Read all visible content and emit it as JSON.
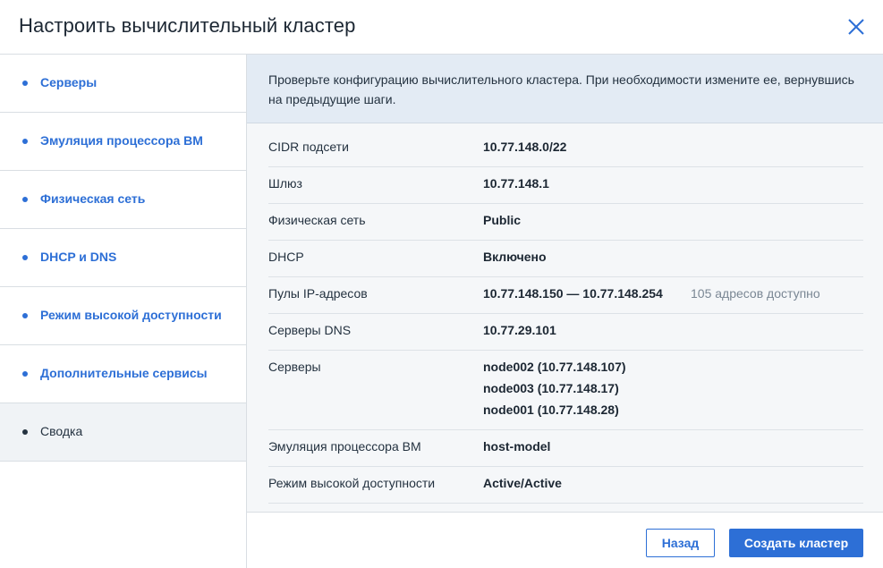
{
  "dialog": {
    "title": "Настроить вычислительный кластер"
  },
  "sidebar": {
    "items": [
      {
        "label": "Серверы"
      },
      {
        "label": "Эмуляция процессора ВМ"
      },
      {
        "label": "Физическая сеть"
      },
      {
        "label": "DHCP и DNS"
      },
      {
        "label": "Режим высокой доступности"
      },
      {
        "label": "Дополнительные сервисы"
      },
      {
        "label": "Сводка"
      }
    ],
    "active_index": 6
  },
  "banner": {
    "text": "Проверьте конфигурацию вычислительного кластера. При необходимости измените ее, вернувшись на предыдущие шаги."
  },
  "summary": {
    "cidr": {
      "key": "CIDR подсети",
      "value": "10.77.148.0/22"
    },
    "gateway": {
      "key": "Шлюз",
      "value": "10.77.148.1"
    },
    "physical_network": {
      "key": "Физическая сеть",
      "value": "Public"
    },
    "dhcp": {
      "key": "DHCP",
      "value": "Включено"
    },
    "ip_pools": {
      "key": "Пулы IP-адресов",
      "value": "10.77.148.150 — 10.77.148.254",
      "extra": "105 адресов доступно"
    },
    "dns": {
      "key": "Серверы DNS",
      "value": "10.77.29.101"
    },
    "servers": {
      "key": "Серверы",
      "values": [
        "node002 (10.77.148.107)",
        "node003 (10.77.148.17)",
        "node001 (10.77.148.28)"
      ]
    },
    "cpu_emulation": {
      "key": "Эмуляция процессора ВМ",
      "value": "host-model"
    },
    "ha_mode": {
      "key": "Режим высокой доступности",
      "value": "Active/Active"
    }
  },
  "footer": {
    "back_label": "Назад",
    "create_label": "Создать кластер"
  },
  "colors": {
    "accent": "#2d6fd6",
    "banner_bg": "#e3ebf4",
    "summary_bg": "#f5f7f9"
  }
}
